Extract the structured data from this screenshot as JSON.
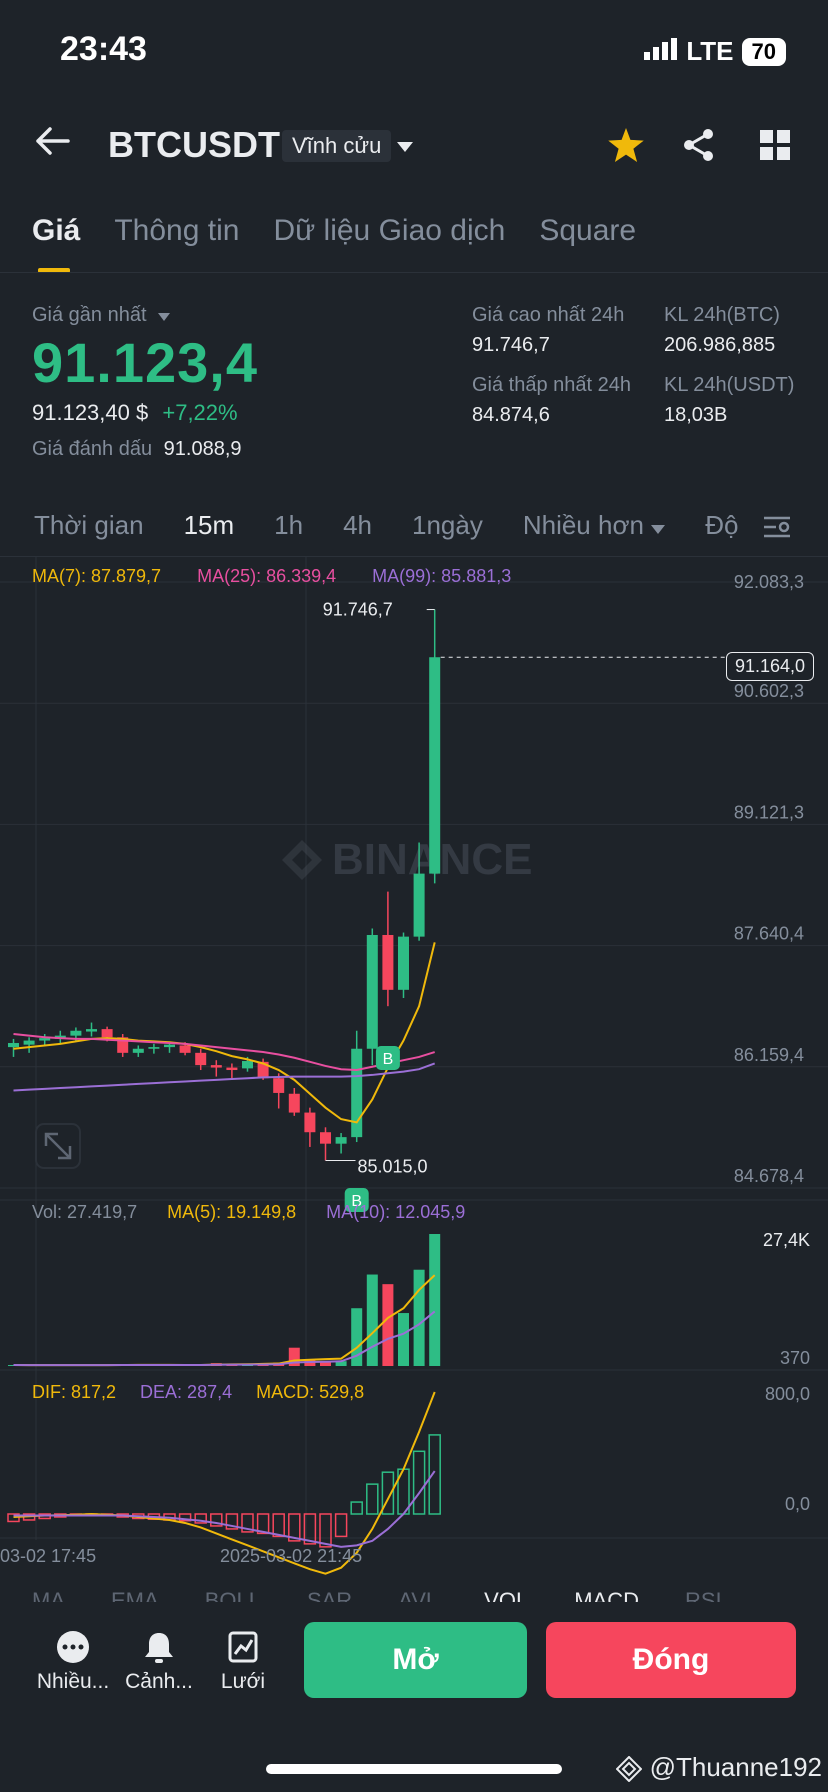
{
  "status": {
    "time": "23:43",
    "network": "LTE",
    "battery": "70"
  },
  "header": {
    "symbol": "BTCUSDT",
    "contract": "Vĩnh cửu"
  },
  "tabs": [
    "Giá",
    "Thông tin",
    "Dữ liệu Giao dịch",
    "Square"
  ],
  "ticker": {
    "last_price_label": "Giá gần nhất",
    "last_price": "91.123,4",
    "usd_price": "91.123,40 $",
    "change": "+7,22%",
    "mark_label": "Giá đánh dấu",
    "mark_price": "91.088,9",
    "high_label": "Giá cao nhất 24h",
    "high": "91.746,7",
    "low_label": "Giá thấp nhất 24h",
    "low": "84.874,6",
    "vol_btc_label": "KL 24h(BTC)",
    "vol_btc": "206.986,885",
    "vol_usdt_label": "KL 24h(USDT)",
    "vol_usdt": "18,03B"
  },
  "intervals": [
    "Thời gian",
    "15m",
    "1h",
    "4h",
    "1ngày",
    "Nhiều hơn",
    "Độ"
  ],
  "selected_interval": "15m",
  "chart": {
    "ma7": "MA(7): 87.879,7",
    "ma25": "MA(25): 86.339,4",
    "ma99": "MA(99): 85.881,3",
    "axis": [
      "92.083,3",
      "90.602,3",
      "89.121,3",
      "87.640,4",
      "86.159,4",
      "84.678,4"
    ],
    "current_price_tag": "91.164,0",
    "high_marker": "91.746,7",
    "low_marker": "85.015,0",
    "watermark": "BINANCE",
    "buy_marker": "B",
    "vol": "Vol: 27.419,7",
    "vol_ma5": "MA(5): 19.149,8",
    "vol_ma10": "MA(10): 12.045,9",
    "vol_axis_top": "27,4K",
    "vol_axis_bottom": "370",
    "dif": "DIF: 817,2",
    "dea": "DEA: 287,4",
    "macd": "MACD: 529,8",
    "macd_axis_top": "800,0",
    "macd_axis_zero": "0,0",
    "time_labels": [
      "03-02 17:45",
      "2025-03-02 21:45"
    ]
  },
  "chart_data": {
    "type": "candlestick",
    "candles": [
      {
        "o": 86400,
        "h": 86500,
        "l": 86280,
        "c": 86450
      },
      {
        "o": 86430,
        "h": 86520,
        "l": 86330,
        "c": 86480
      },
      {
        "o": 86480,
        "h": 86560,
        "l": 86420,
        "c": 86510
      },
      {
        "o": 86500,
        "h": 86600,
        "l": 86450,
        "c": 86540
      },
      {
        "o": 86540,
        "h": 86640,
        "l": 86480,
        "c": 86600
      },
      {
        "o": 86590,
        "h": 86700,
        "l": 86530,
        "c": 86620
      },
      {
        "o": 86620,
        "h": 86650,
        "l": 86470,
        "c": 86520
      },
      {
        "o": 86520,
        "h": 86560,
        "l": 86280,
        "c": 86330
      },
      {
        "o": 86330,
        "h": 86420,
        "l": 86280,
        "c": 86380
      },
      {
        "o": 86380,
        "h": 86440,
        "l": 86320,
        "c": 86400
      },
      {
        "o": 86400,
        "h": 86460,
        "l": 86330,
        "c": 86430
      },
      {
        "o": 86420,
        "h": 86460,
        "l": 86300,
        "c": 86330
      },
      {
        "o": 86330,
        "h": 86380,
        "l": 86120,
        "c": 86180
      },
      {
        "o": 86180,
        "h": 86240,
        "l": 86040,
        "c": 86150
      },
      {
        "o": 86150,
        "h": 86200,
        "l": 86020,
        "c": 86120
      },
      {
        "o": 86140,
        "h": 86280,
        "l": 86100,
        "c": 86230
      },
      {
        "o": 86220,
        "h": 86260,
        "l": 86000,
        "c": 86020
      },
      {
        "o": 86020,
        "h": 86080,
        "l": 85650,
        "c": 85840
      },
      {
        "o": 85830,
        "h": 85900,
        "l": 85560,
        "c": 85600
      },
      {
        "o": 85600,
        "h": 85660,
        "l": 85180,
        "c": 85360
      },
      {
        "o": 85360,
        "h": 85420,
        "l": 85015,
        "c": 85220
      },
      {
        "o": 85220,
        "h": 85350,
        "l": 85100,
        "c": 85300
      },
      {
        "o": 85300,
        "h": 86600,
        "l": 85240,
        "c": 86380
      },
      {
        "o": 86380,
        "h": 87850,
        "l": 86180,
        "c": 87770
      },
      {
        "o": 87770,
        "h": 88300,
        "l": 86900,
        "c": 87100
      },
      {
        "o": 87100,
        "h": 87800,
        "l": 87000,
        "c": 87750
      },
      {
        "o": 87750,
        "h": 88900,
        "l": 87700,
        "c": 88520
      },
      {
        "o": 88520,
        "h": 91746.7,
        "l": 88400,
        "c": 91164
      }
    ],
    "ma7": [
      86380,
      86400,
      86420,
      86440,
      86470,
      86500,
      86510,
      86500,
      86480,
      86470,
      86460,
      86440,
      86400,
      86350,
      86290,
      86250,
      86200,
      86120,
      86000,
      85830,
      85660,
      85520,
      85480,
      85760,
      86150,
      86480,
      86900,
      87680
    ],
    "ma25": [
      86560,
      86540,
      86520,
      86510,
      86500,
      86500,
      86490,
      86480,
      86470,
      86460,
      86450,
      86440,
      86420,
      86400,
      86380,
      86360,
      86340,
      86310,
      86270,
      86220,
      86170,
      86130,
      86120,
      86160,
      86200,
      86240,
      86280,
      86340
    ],
    "ma99": [
      85870,
      85880,
      85890,
      85900,
      85910,
      85920,
      85930,
      85940,
      85950,
      85960,
      85970,
      85980,
      85990,
      86000,
      86010,
      86020,
      86030,
      86035,
      86040,
      86040,
      86040,
      86040,
      86045,
      86060,
      86080,
      86100,
      86130,
      86200
    ],
    "volume": [
      200,
      180,
      160,
      150,
      170,
      210,
      250,
      260,
      220,
      200,
      190,
      180,
      300,
      600,
      400,
      350,
      500,
      700,
      3800,
      1200,
      900,
      1000,
      12000,
      19000,
      17000,
      11000,
      20000,
      27419.7
    ],
    "macd_hist": [
      -50,
      -40,
      -30,
      -20,
      -10,
      -5,
      -10,
      -20,
      -30,
      -35,
      -40,
      -45,
      -60,
      -80,
      -100,
      -120,
      -130,
      -150,
      -180,
      -200,
      -220,
      -150,
      80,
      200,
      280,
      300,
      420,
      529.8
    ],
    "dif": [
      -20,
      -15,
      -10,
      -8,
      -5,
      0,
      -5,
      -10,
      -20,
      -30,
      -40,
      -60,
      -90,
      -130,
      -170,
      -210,
      -250,
      -290,
      -330,
      -370,
      -400,
      -360,
      -260,
      -100,
      100,
      300,
      550,
      817.2
    ],
    "dea": [
      -10,
      -10,
      -10,
      -10,
      -10,
      -10,
      -10,
      -10,
      -15,
      -20,
      -25,
      -35,
      -45,
      -60,
      -80,
      -100,
      -120,
      -140,
      -160,
      -180,
      -200,
      -220,
      -210,
      -180,
      -100,
      0,
      140,
      287.4
    ],
    "ylim": [
      84678.4,
      92083.3
    ]
  },
  "indicator_tabs": [
    "MA",
    "EMA",
    "BOLL",
    "SAR",
    "AVL",
    "VOL",
    "MACD",
    "RSI"
  ],
  "bottom_nav": {
    "more": "Nhiều...",
    "alert": "Cảnh...",
    "grid": "Lưới"
  },
  "actions": {
    "open": "Mở",
    "close": "Đóng"
  },
  "watermark_user": "@Thuanne192"
}
